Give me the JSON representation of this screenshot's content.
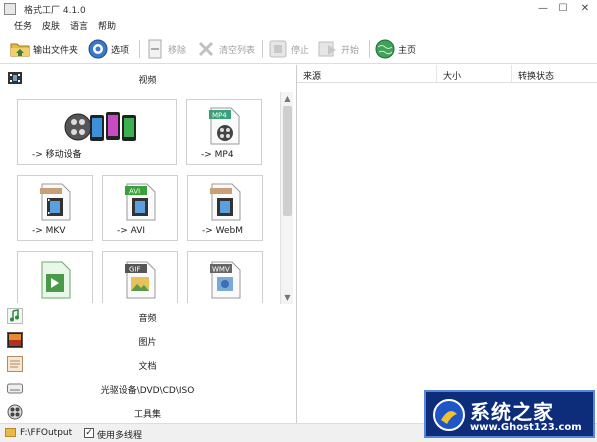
{
  "window": {
    "title": "格式工厂 4.1.0"
  },
  "menu": [
    "任务",
    "皮肤",
    "语言",
    "帮助"
  ],
  "toolbar": {
    "output_folder": "输出文件夹",
    "options": "选项",
    "remove": "移除",
    "clear_list": "清空列表",
    "stop": "停止",
    "start": "开始",
    "home": "主页"
  },
  "categories": {
    "video": "视频",
    "audio": "音频",
    "picture": "图片",
    "document": "文档",
    "rom": "光驱设备\\DVD\\CD\\ISO",
    "tools": "工具集"
  },
  "tiles": {
    "mobile": "-> 移动设备",
    "mp4": "-> MP4",
    "mkv": "-> MKV",
    "avi": "-> AVI",
    "webm": "-> WebM"
  },
  "badges": {
    "mp4": "MP4",
    "avi": "AVI",
    "gif": "GIF",
    "wmv": "WMV"
  },
  "task_columns": [
    "来源",
    "大小",
    "转换状态"
  ],
  "status": {
    "output_path": "F:\\FFOutput",
    "multithread_label": "使用多线程",
    "multithread_checked": true
  },
  "watermark": {
    "title": "系统之家",
    "url": "www.Ghost123.com"
  }
}
